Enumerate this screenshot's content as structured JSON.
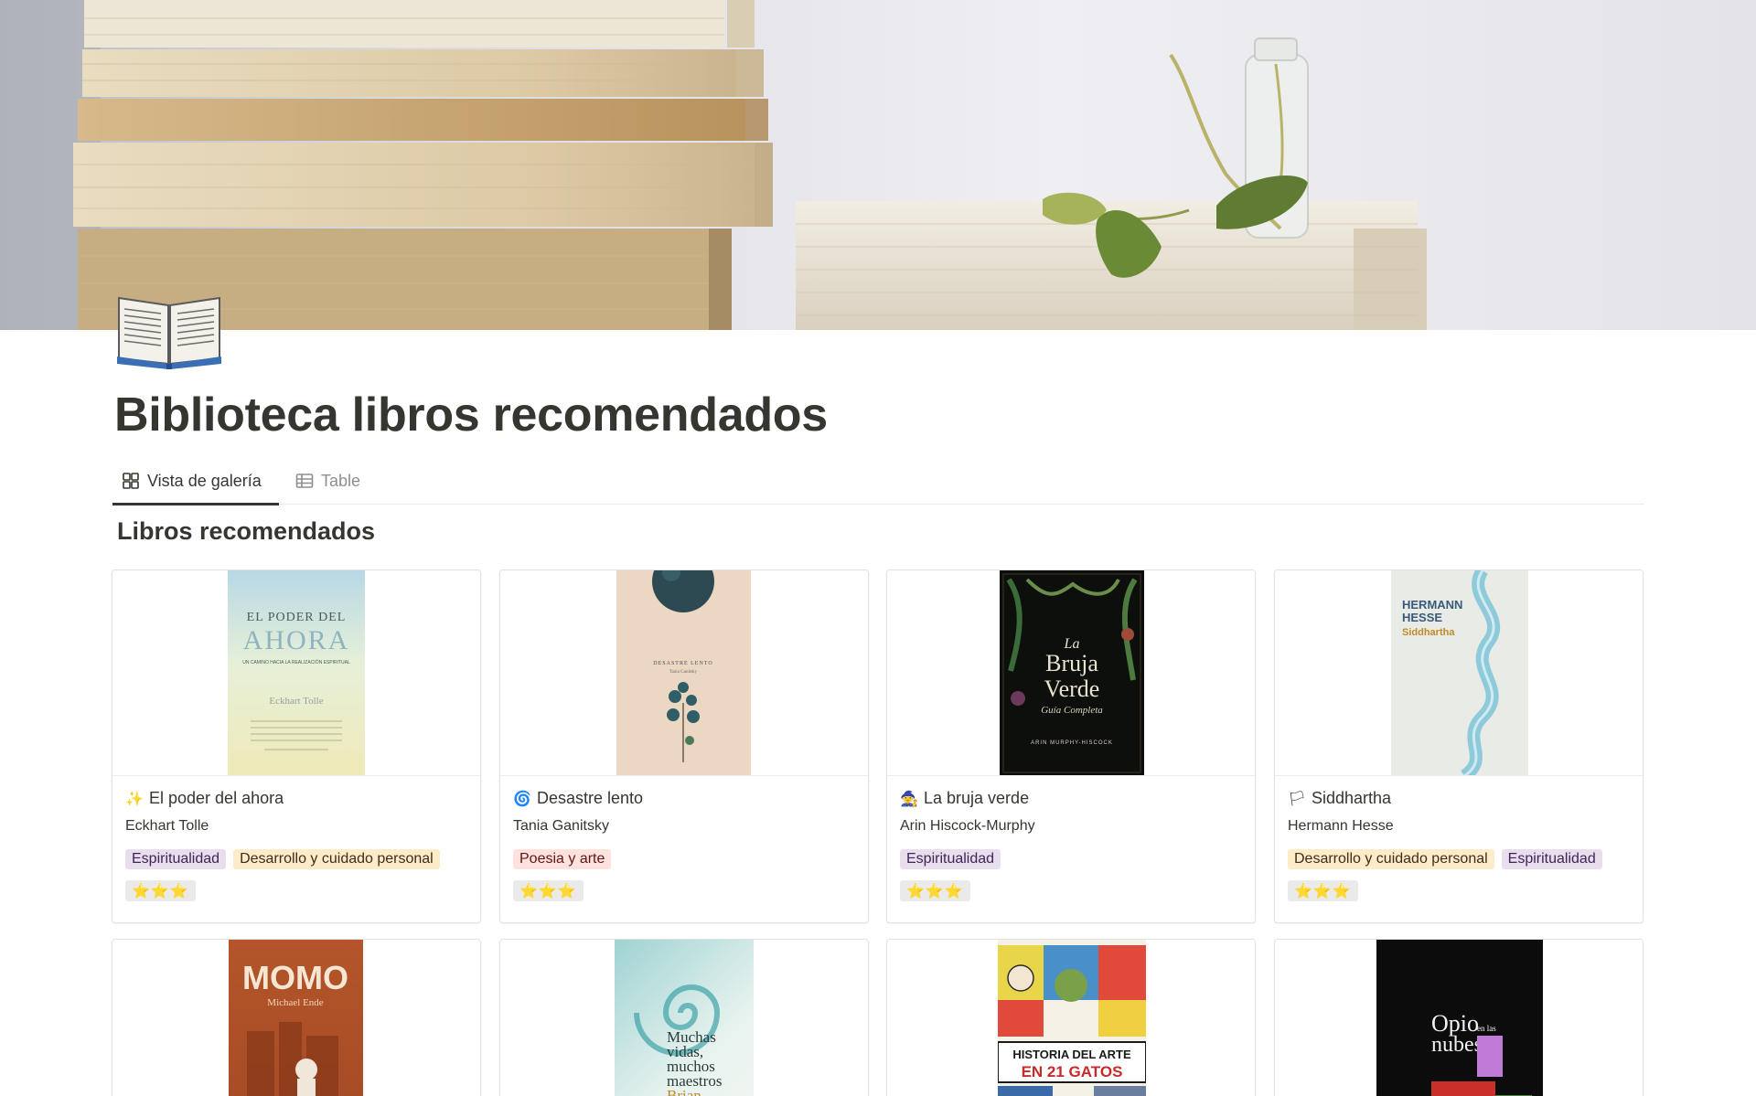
{
  "page": {
    "title": "Biblioteca libros recomendados",
    "icon": "open-book-icon"
  },
  "tabs": [
    {
      "label": "Vista de galería",
      "icon": "gallery-grid-icon",
      "active": true
    },
    {
      "label": "Table",
      "icon": "table-icon",
      "active": false
    }
  ],
  "section": {
    "title": "Libros recomendados"
  },
  "tag_colors": {
    "Espiritualidad": {
      "bg": "#e8deee",
      "fg": "#412454"
    },
    "Desarrollo y cuidado personal": {
      "bg": "#fdecc8",
      "fg": "#402c1b"
    },
    "Poesia y arte": {
      "bg": "#ffe2dd",
      "fg": "#5d1715"
    }
  },
  "books": [
    {
      "emoji": "✨",
      "title": "El poder del ahora",
      "author": "Eckhart Tolle",
      "tags": [
        "Espiritualidad",
        "Desarrollo y cuidado personal"
      ],
      "rating": "⭐⭐⭐",
      "cover": {
        "lines": [
          "EL PODER DEL",
          "AHORA",
          "UN CAMINO HACIA LA REALIZACIÓN ESPIRITUAL",
          "Eckhart Tolle"
        ]
      }
    },
    {
      "emoji": "🌀",
      "title": "Desastre lento",
      "author": "Tania Ganitsky",
      "tags": [
        "Poesia y arte"
      ],
      "rating": "⭐⭐⭐",
      "cover": {
        "lines": [
          "DESASTRE LENTO",
          "Tania Ganitsky"
        ]
      }
    },
    {
      "emoji": "🧙",
      "title": "La bruja verde",
      "author": "Arin Hiscock-Murphy",
      "tags": [
        "Espiritualidad"
      ],
      "rating": "⭐⭐⭐",
      "cover": {
        "lines": [
          "La",
          "Bruja",
          "Verde",
          "Guía Completa",
          "ARIN MURPHY-HISCOCK"
        ]
      }
    },
    {
      "emoji": "🏳",
      "title": "Siddhartha",
      "author": "Hermann Hesse",
      "tags": [
        "Desarrollo y cuidado personal",
        "Espiritualidad"
      ],
      "rating": "⭐⭐⭐",
      "cover": {
        "lines": [
          "HERMANN",
          "HESSE",
          "Siddhartha"
        ]
      }
    },
    {
      "cover": {
        "lines": [
          "MOMO",
          "Michael Ende"
        ]
      }
    },
    {
      "cover": {
        "lines": [
          "Muchas",
          "vidas,",
          "muchos",
          "maestros",
          "Brian"
        ]
      }
    },
    {
      "cover": {
        "lines": [
          "HISTORIA DEL ARTE",
          "EN 21 GATOS"
        ]
      }
    },
    {
      "cover": {
        "lines": [
          "Opio",
          "en las",
          "nubes"
        ]
      }
    }
  ]
}
